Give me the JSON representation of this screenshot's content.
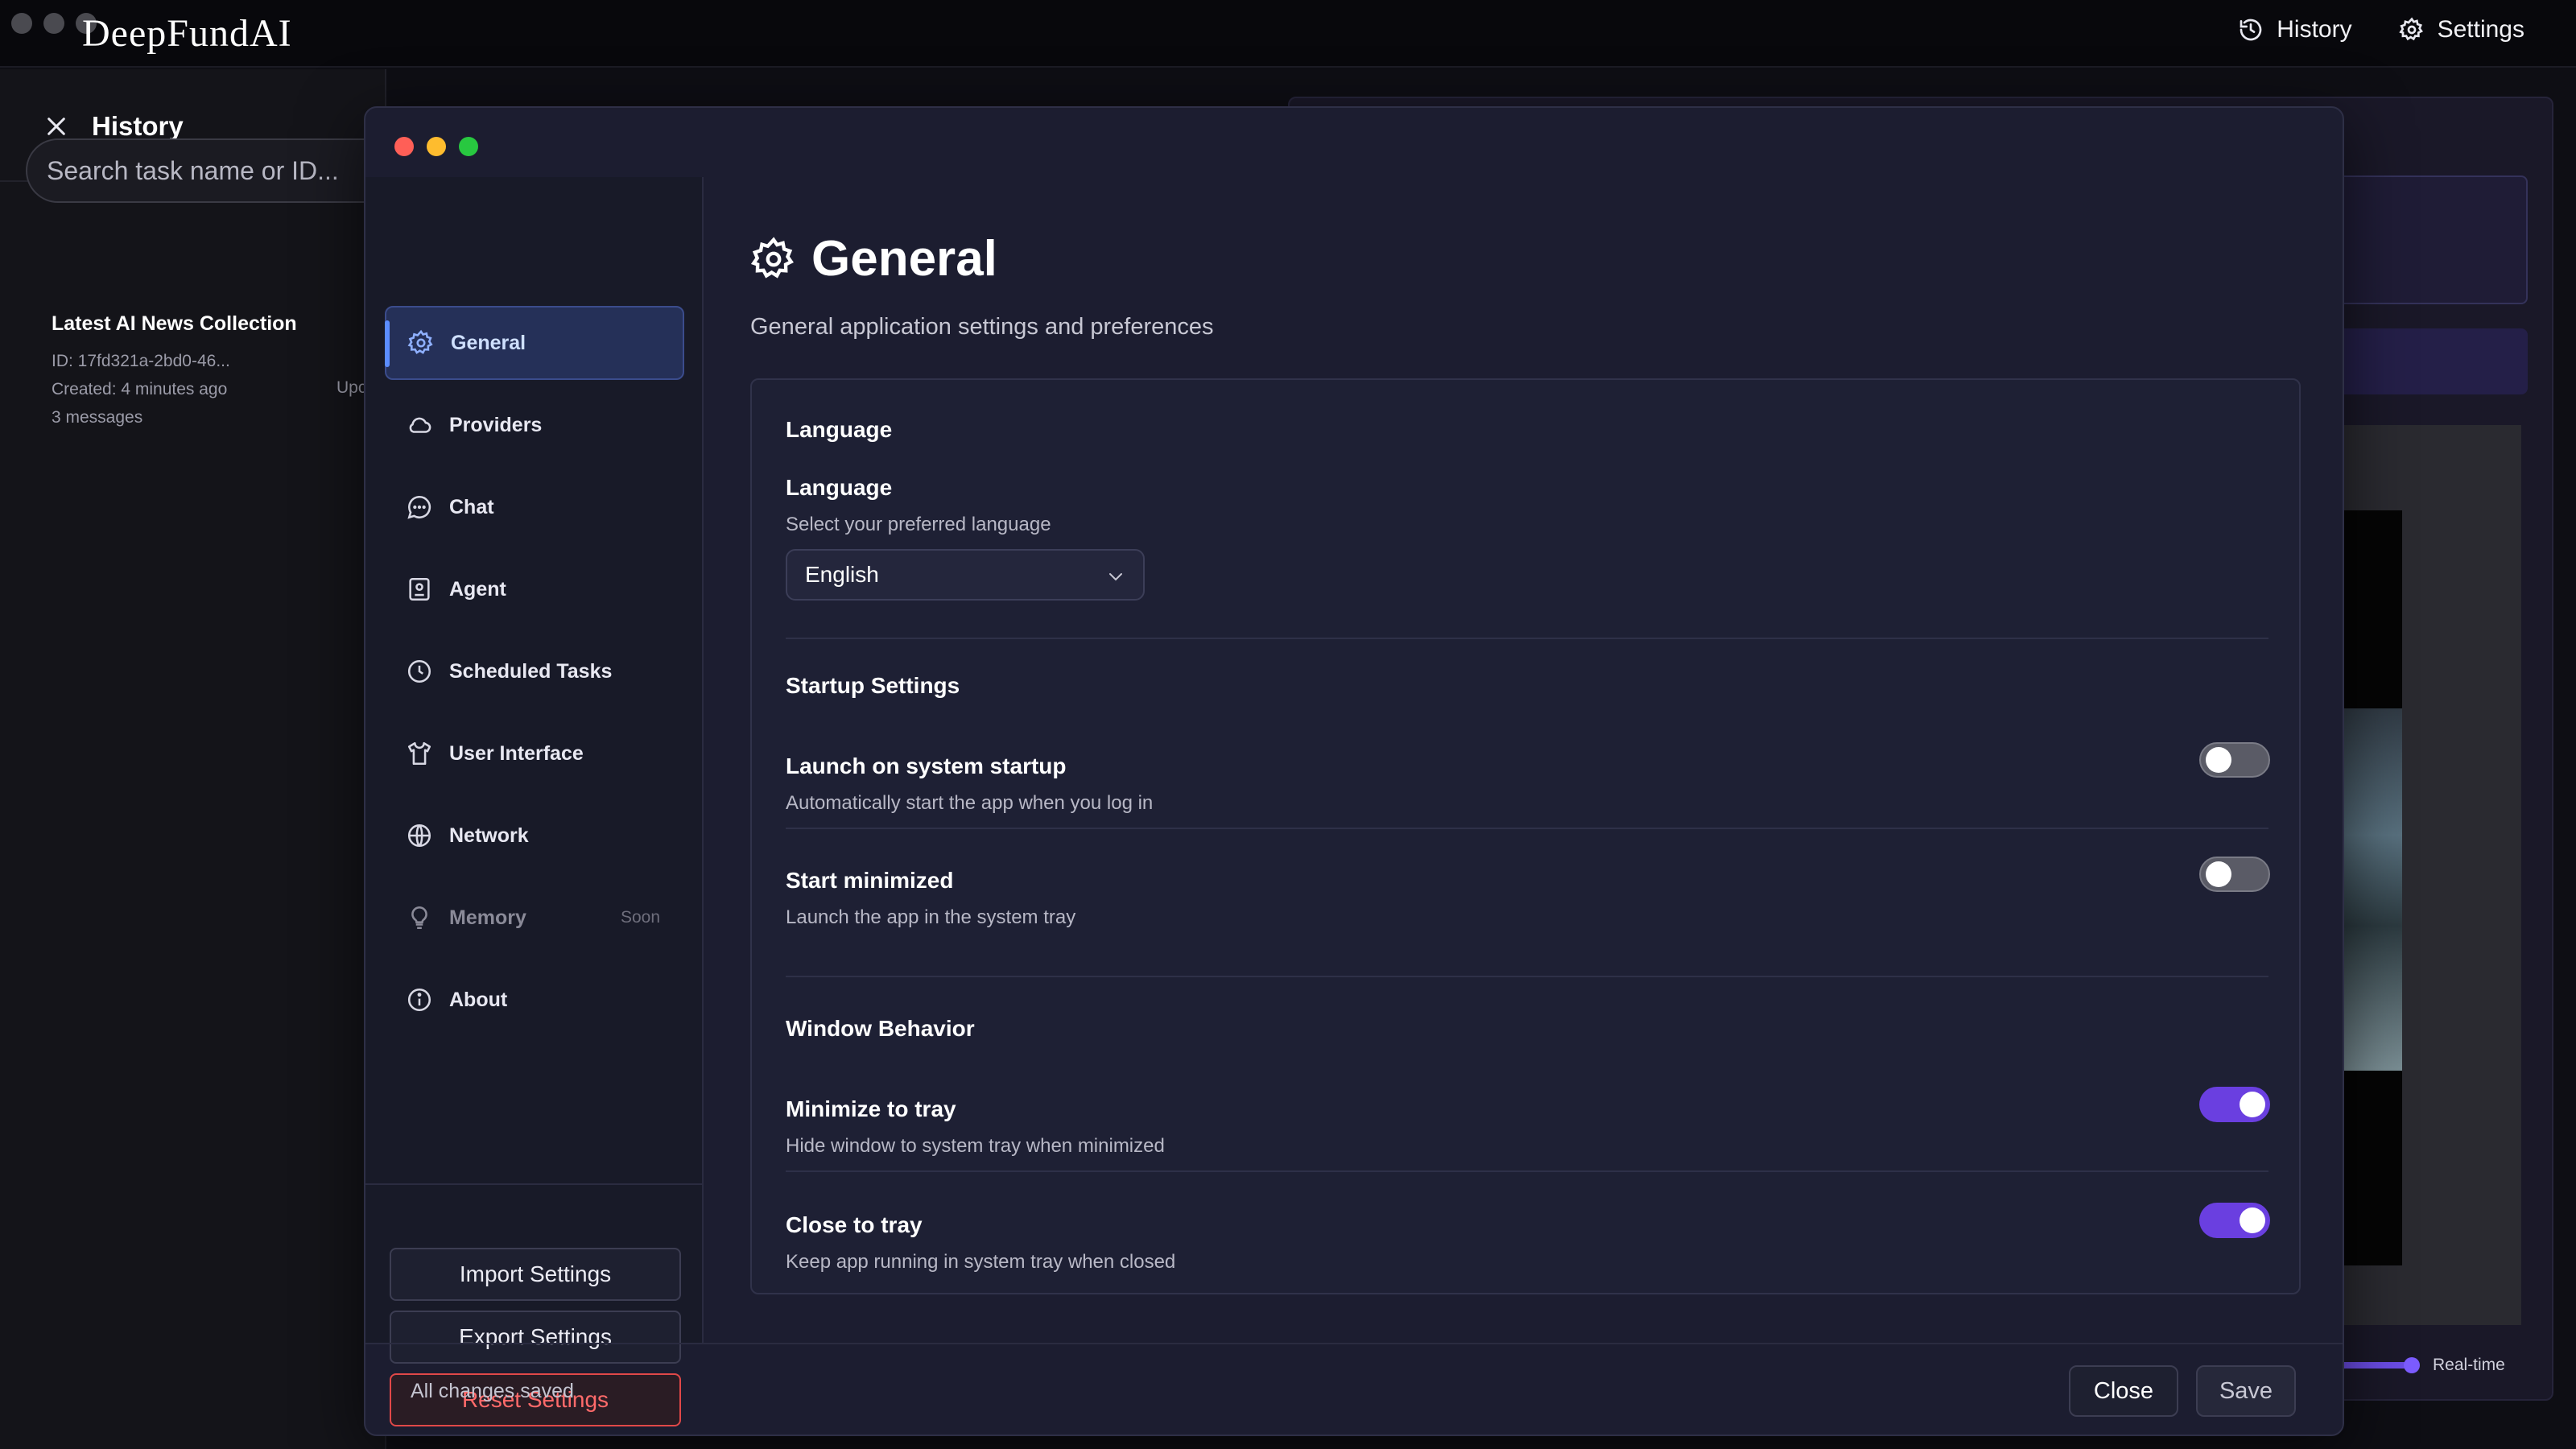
{
  "topbar": {
    "brand": "DeepFundAI",
    "history_label": "History",
    "settings_label": "Settings"
  },
  "history": {
    "title": "History",
    "search_placeholder": "Search task name or ID...",
    "items": [
      {
        "title": "Latest AI News Collection",
        "id": "ID: 17fd321a-2bd0-46...",
        "created": "Created: 4 minutes ago",
        "messages": "3 messages",
        "updated_partial": "Upc"
      }
    ]
  },
  "background": {
    "realtime_label": "Real-time"
  },
  "settings": {
    "nav": [
      {
        "label": "General",
        "icon": "gear-icon",
        "active": true
      },
      {
        "label": "Providers",
        "icon": "cloud-icon"
      },
      {
        "label": "Chat",
        "icon": "chat-bubble-icon"
      },
      {
        "label": "Agent",
        "icon": "agent-icon"
      },
      {
        "label": "Scheduled Tasks",
        "icon": "clock-icon"
      },
      {
        "label": "User Interface",
        "icon": "shirt-icon"
      },
      {
        "label": "Network",
        "icon": "globe-icon"
      },
      {
        "label": "Memory",
        "icon": "lightbulb-icon",
        "badge": "Soon",
        "disabled": true
      },
      {
        "label": "About",
        "icon": "info-icon"
      }
    ],
    "import_label": "Import Settings",
    "export_label": "Export Settings",
    "reset_label": "Reset Settings",
    "page_title": "General",
    "page_subtitle": "General application settings and preferences",
    "language": {
      "section": "Language",
      "title": "Language",
      "desc": "Select your preferred language",
      "value": "English"
    },
    "startup": {
      "section": "Startup Settings",
      "launch_title": "Launch on system startup",
      "launch_desc": "Automatically start the app when you log in",
      "launch_on": false,
      "minimized_title": "Start minimized",
      "minimized_desc": "Launch the app in the system tray",
      "minimized_on": false
    },
    "window": {
      "section": "Window Behavior",
      "min_tray_title": "Minimize to tray",
      "min_tray_desc": "Hide window to system tray when minimized",
      "min_tray_on": true,
      "close_tray_title": "Close to tray",
      "close_tray_desc": "Keep app running in system tray when closed",
      "close_tray_on": true
    },
    "footer": {
      "status": "All changes saved",
      "close_label": "Close",
      "save_label": "Save"
    },
    "colors": {
      "accent": "#6a3fe0",
      "active_nav": "#253058",
      "danger": "#e04848"
    }
  }
}
